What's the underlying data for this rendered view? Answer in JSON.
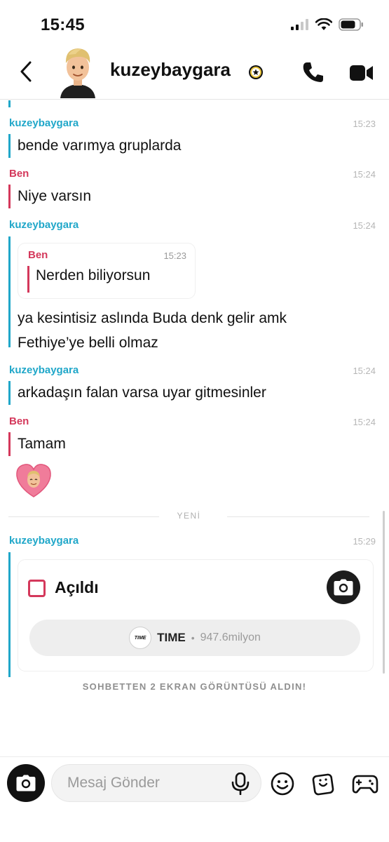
{
  "status_bar": {
    "time": "15:45"
  },
  "header": {
    "contact_name": "kuzeybaygara"
  },
  "messages": [
    {
      "sender": "kuzeybaygara",
      "time": "15:23",
      "lines": [
        "bende varımya gruplarda"
      ]
    },
    {
      "sender": "Ben",
      "time": "15:24",
      "lines": [
        "Niye varsın"
      ]
    },
    {
      "sender": "kuzeybaygara",
      "time": "15:24",
      "quote": {
        "sender": "Ben",
        "time": "15:23",
        "text": "Nerden biliyorsun"
      },
      "lines": [
        "ya kesintisiz aslında Buda denk gelir amk",
        "Fethiye’ye belli olmaz"
      ]
    },
    {
      "sender": "kuzeybaygara",
      "time": "15:24",
      "lines": [
        "arkadaşın falan varsa uyar gitmesinler"
      ]
    },
    {
      "sender": "Ben",
      "time": "15:24",
      "lines": [
        "Tamam"
      ],
      "reaction": "bitmoji-heart"
    }
  ],
  "divider_label": "YENİ",
  "snap_message": {
    "sender": "kuzeybaygara",
    "time": "15:29",
    "status": "Açıldı",
    "lens_logo_text": "TIME",
    "lens_name": "TIME",
    "lens_dot": "•",
    "lens_views": "947.6milyon"
  },
  "screenshot_note": "SOHBETTEN 2 EKRAN GÖRÜNTÜSÜ ALDIN!",
  "composer": {
    "placeholder": "Mesaj Gönder"
  },
  "colors": {
    "them": "#20a7c9",
    "me": "#d4385b"
  }
}
